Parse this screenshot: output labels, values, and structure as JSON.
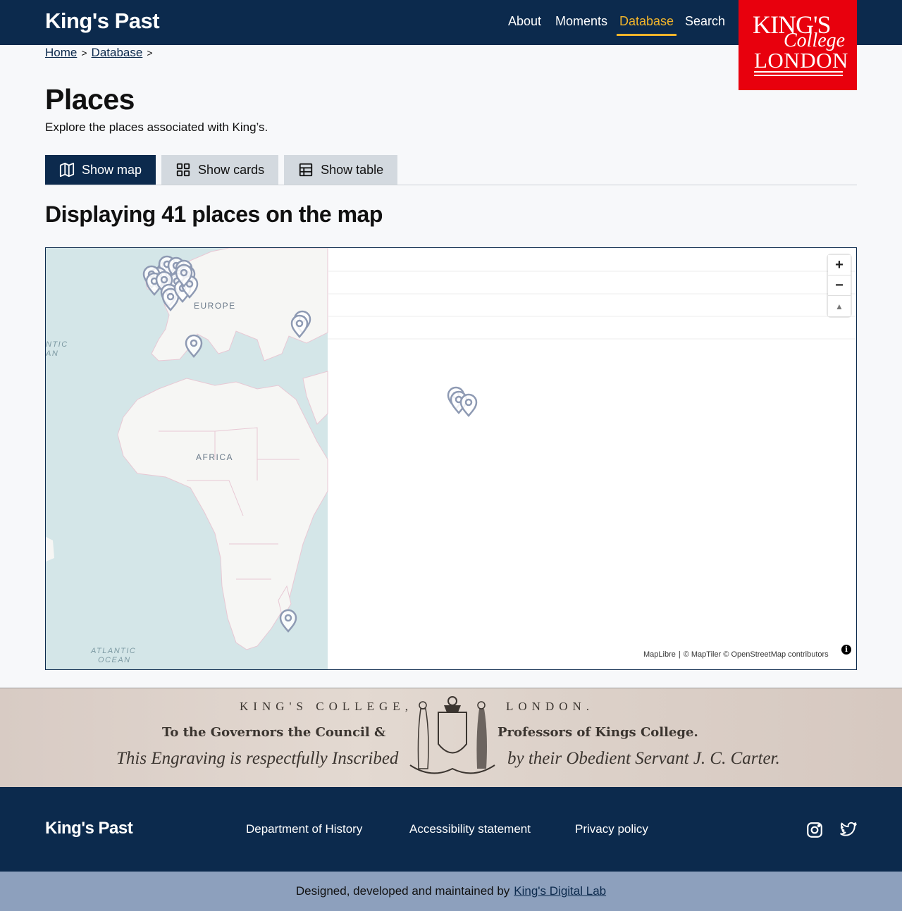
{
  "header": {
    "site_title": "King's Past",
    "nav": [
      {
        "label": "About",
        "active": false
      },
      {
        "label": "Moments",
        "active": false
      },
      {
        "label": "Database",
        "active": true
      },
      {
        "label": "Search",
        "active": false
      }
    ],
    "logo": {
      "line1": "KING'S",
      "line2": "College",
      "line3": "LONDON"
    }
  },
  "breadcrumb": {
    "items": [
      "Home",
      "Database"
    ],
    "separator": ">"
  },
  "page": {
    "title": "Places",
    "intro": "Explore the places associated with King’s.",
    "view_tabs": [
      {
        "label": "Show map",
        "icon": "map-icon",
        "active": true
      },
      {
        "label": "Show cards",
        "icon": "grid-icon",
        "active": false
      },
      {
        "label": "Show table",
        "icon": "table-icon",
        "active": false
      }
    ],
    "section_title": "Displaying 41 places on the map"
  },
  "map": {
    "labels": {
      "europe": "EUROPE",
      "africa": "AFRICA",
      "atlantic_top_1": "NTIC",
      "atlantic_top_2": "AN",
      "atlantic_bottom_1": "ATLANTIC",
      "atlantic_bottom_2": "OCEAN"
    },
    "controls": {
      "zoom_in": "+",
      "zoom_out": "−",
      "compass": "▲"
    },
    "attribution": {
      "maplibre": "MapLibre",
      "sep": "|",
      "credits": "© MapTiler © OpenStreetMap contributors",
      "info": "i"
    },
    "colors": {
      "sea": "#d4e6e8",
      "land": "#f6f6f4",
      "border": "#e8c8d4",
      "marker": "#8e9ab3"
    }
  },
  "engraving": {
    "line1_left": "KING'S  COLLEGE,",
    "line1_right": "LONDON.",
    "line2_left": "To the Governors the Council &",
    "line2_right": "Professors of Kings College.",
    "line3_left": "This Engraving is respectfully Inscribed",
    "line3_right": "by their Obedient Servant J. C. Carter."
  },
  "footer": {
    "title": "King's Past",
    "links": [
      "Department of History",
      "Accessibility statement",
      "Privacy policy"
    ],
    "social": [
      "instagram-icon",
      "twitter-icon"
    ],
    "credit_prefix": "Designed, developed and maintained by",
    "credit_link": "King's Digital Lab"
  }
}
